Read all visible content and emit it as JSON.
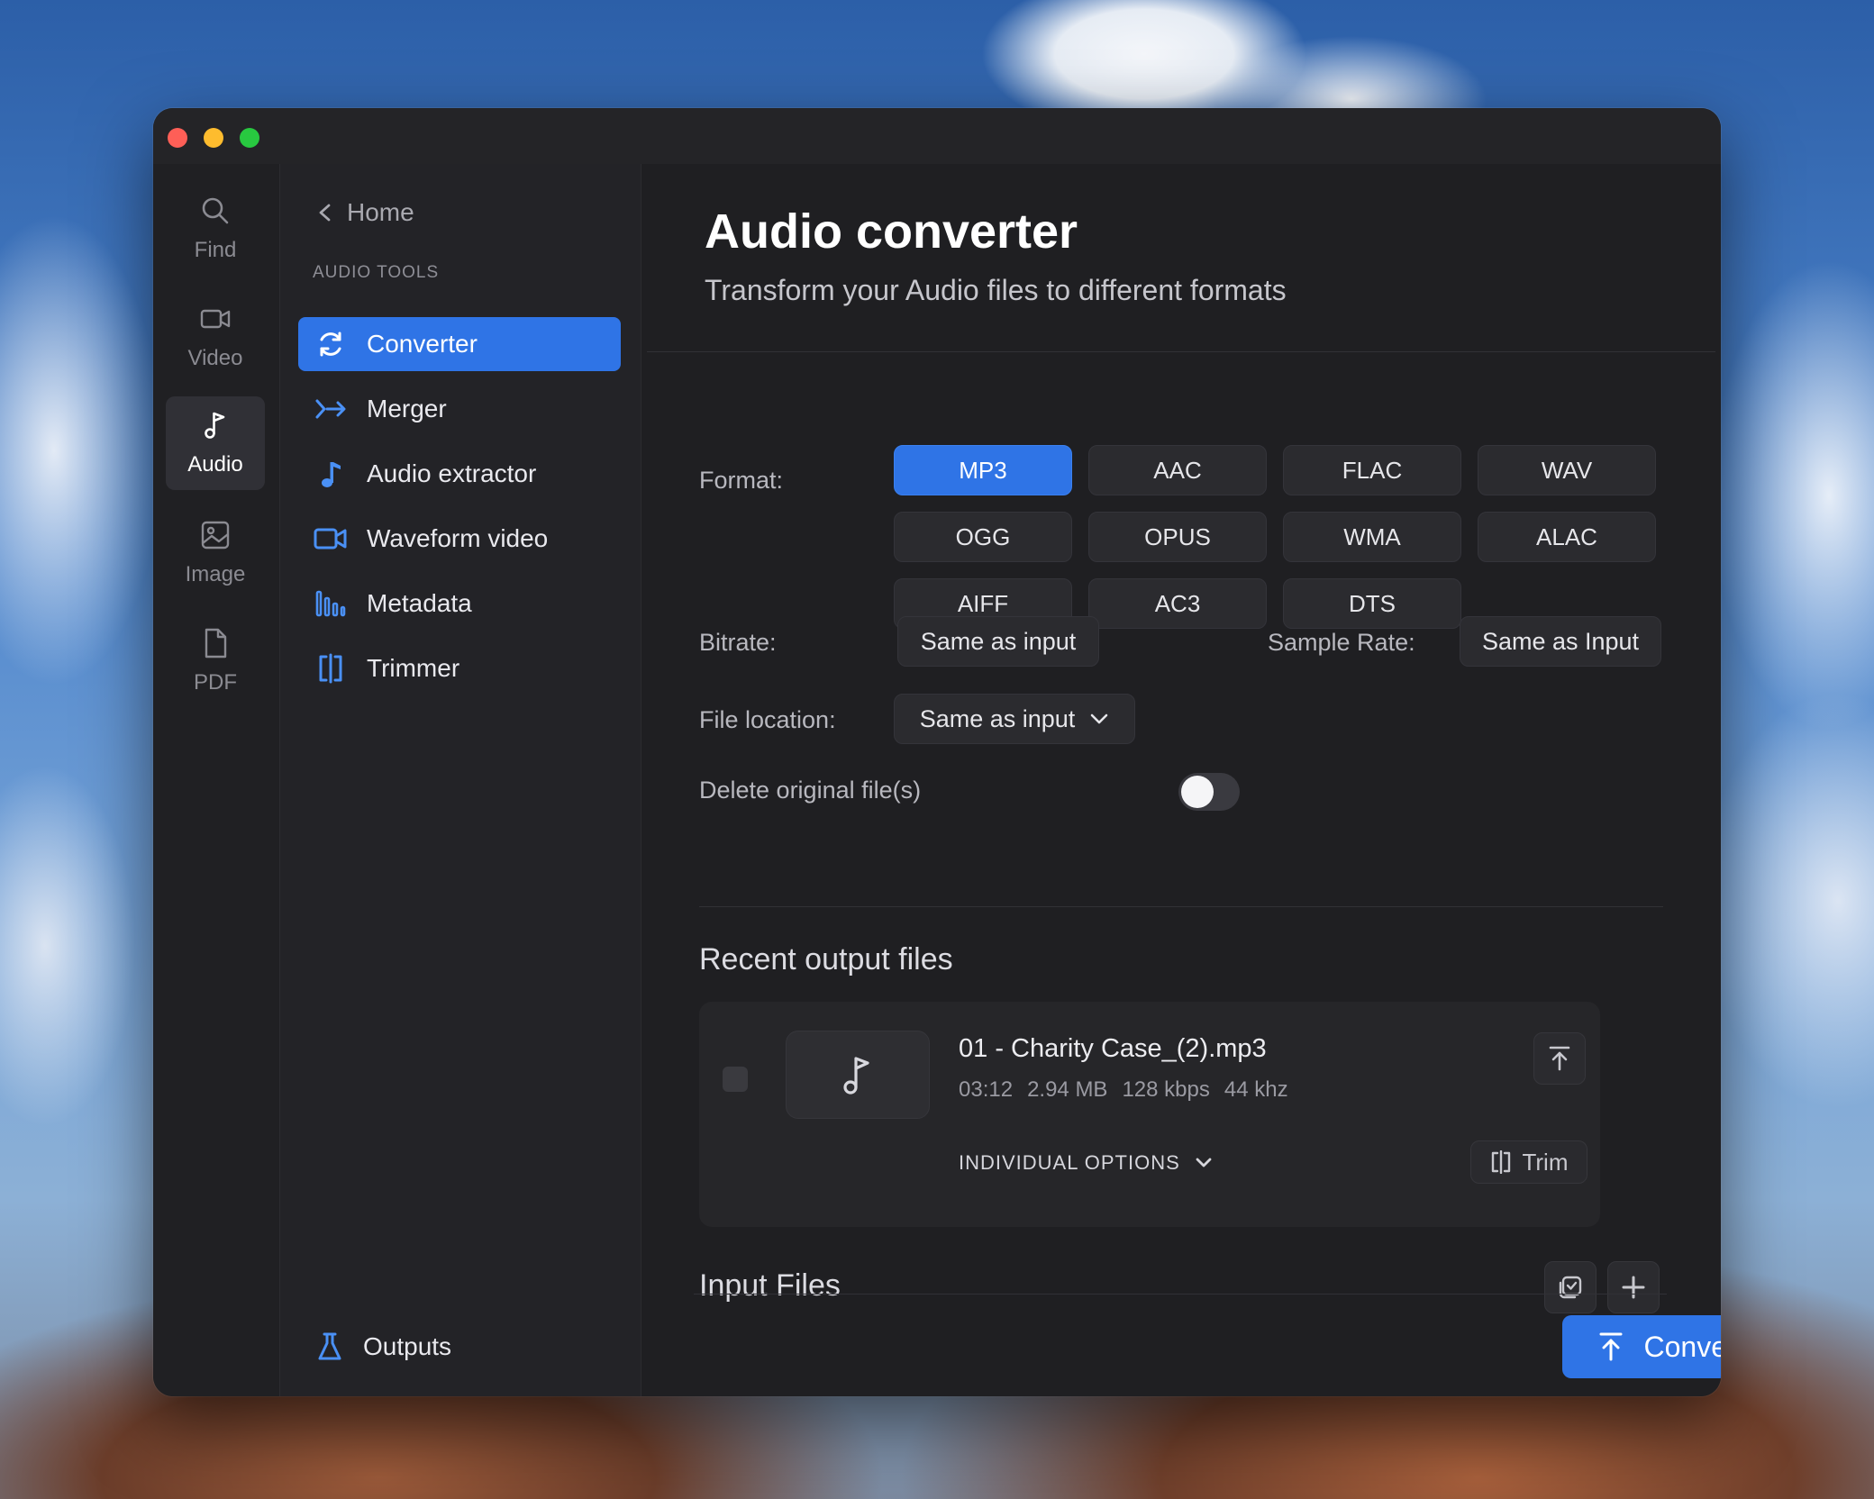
{
  "rail": {
    "items": [
      {
        "label": "Find",
        "icon": "search-icon"
      },
      {
        "label": "Video",
        "icon": "video-camera-icon"
      },
      {
        "label": "Audio",
        "icon": "music-note-icon",
        "active": true
      },
      {
        "label": "Image",
        "icon": "image-icon"
      },
      {
        "label": "PDF",
        "icon": "document-icon"
      }
    ]
  },
  "sidebar": {
    "home_label": "Home",
    "section_label": "AUDIO TOOLS",
    "items": [
      {
        "label": "Converter",
        "icon": "refresh-cycle-icon",
        "active": true
      },
      {
        "label": "Merger",
        "icon": "merge-arrows-icon"
      },
      {
        "label": "Audio extractor",
        "icon": "music-note-icon"
      },
      {
        "label": "Waveform video",
        "icon": "video-camera-icon"
      },
      {
        "label": "Metadata",
        "icon": "bars-icon"
      },
      {
        "label": "Trimmer",
        "icon": "trim-brackets-icon"
      }
    ],
    "outputs_label": "Outputs"
  },
  "main": {
    "title": "Audio converter",
    "subtitle": "Transform your Audio files to different formats",
    "format_label": "Format:",
    "formats": [
      "MP3",
      "AAC",
      "FLAC",
      "WAV",
      "OGG",
      "OPUS",
      "WMA",
      "ALAC",
      "AIFF",
      "AC3",
      "DTS"
    ],
    "selected_format": "MP3",
    "bitrate_label": "Bitrate:",
    "bitrate_value": "Same as input",
    "sample_rate_label": "Sample Rate:",
    "sample_rate_value": "Same as Input",
    "file_location_label": "File location:",
    "file_location_value": "Same as input",
    "delete_label": "Delete original file(s)",
    "delete_enabled": false,
    "recent_title": "Recent output files",
    "recent_files": [
      {
        "name": "01 - Charity Case_(2).mp3",
        "duration": "03:12",
        "size": "2.94 MB",
        "bitrate": "128 kbps",
        "sample_rate": "44 khz",
        "options_label": "INDIVIDUAL OPTIONS",
        "trim_label": "Trim"
      }
    ],
    "input_title": "Input Files",
    "convert_label": "Convert all"
  },
  "colors": {
    "accent": "#2f74e6",
    "window_bg": "#1d1d20",
    "traffic_red": "#fe5f57",
    "traffic_yellow": "#febc2e",
    "traffic_green": "#28c840"
  }
}
